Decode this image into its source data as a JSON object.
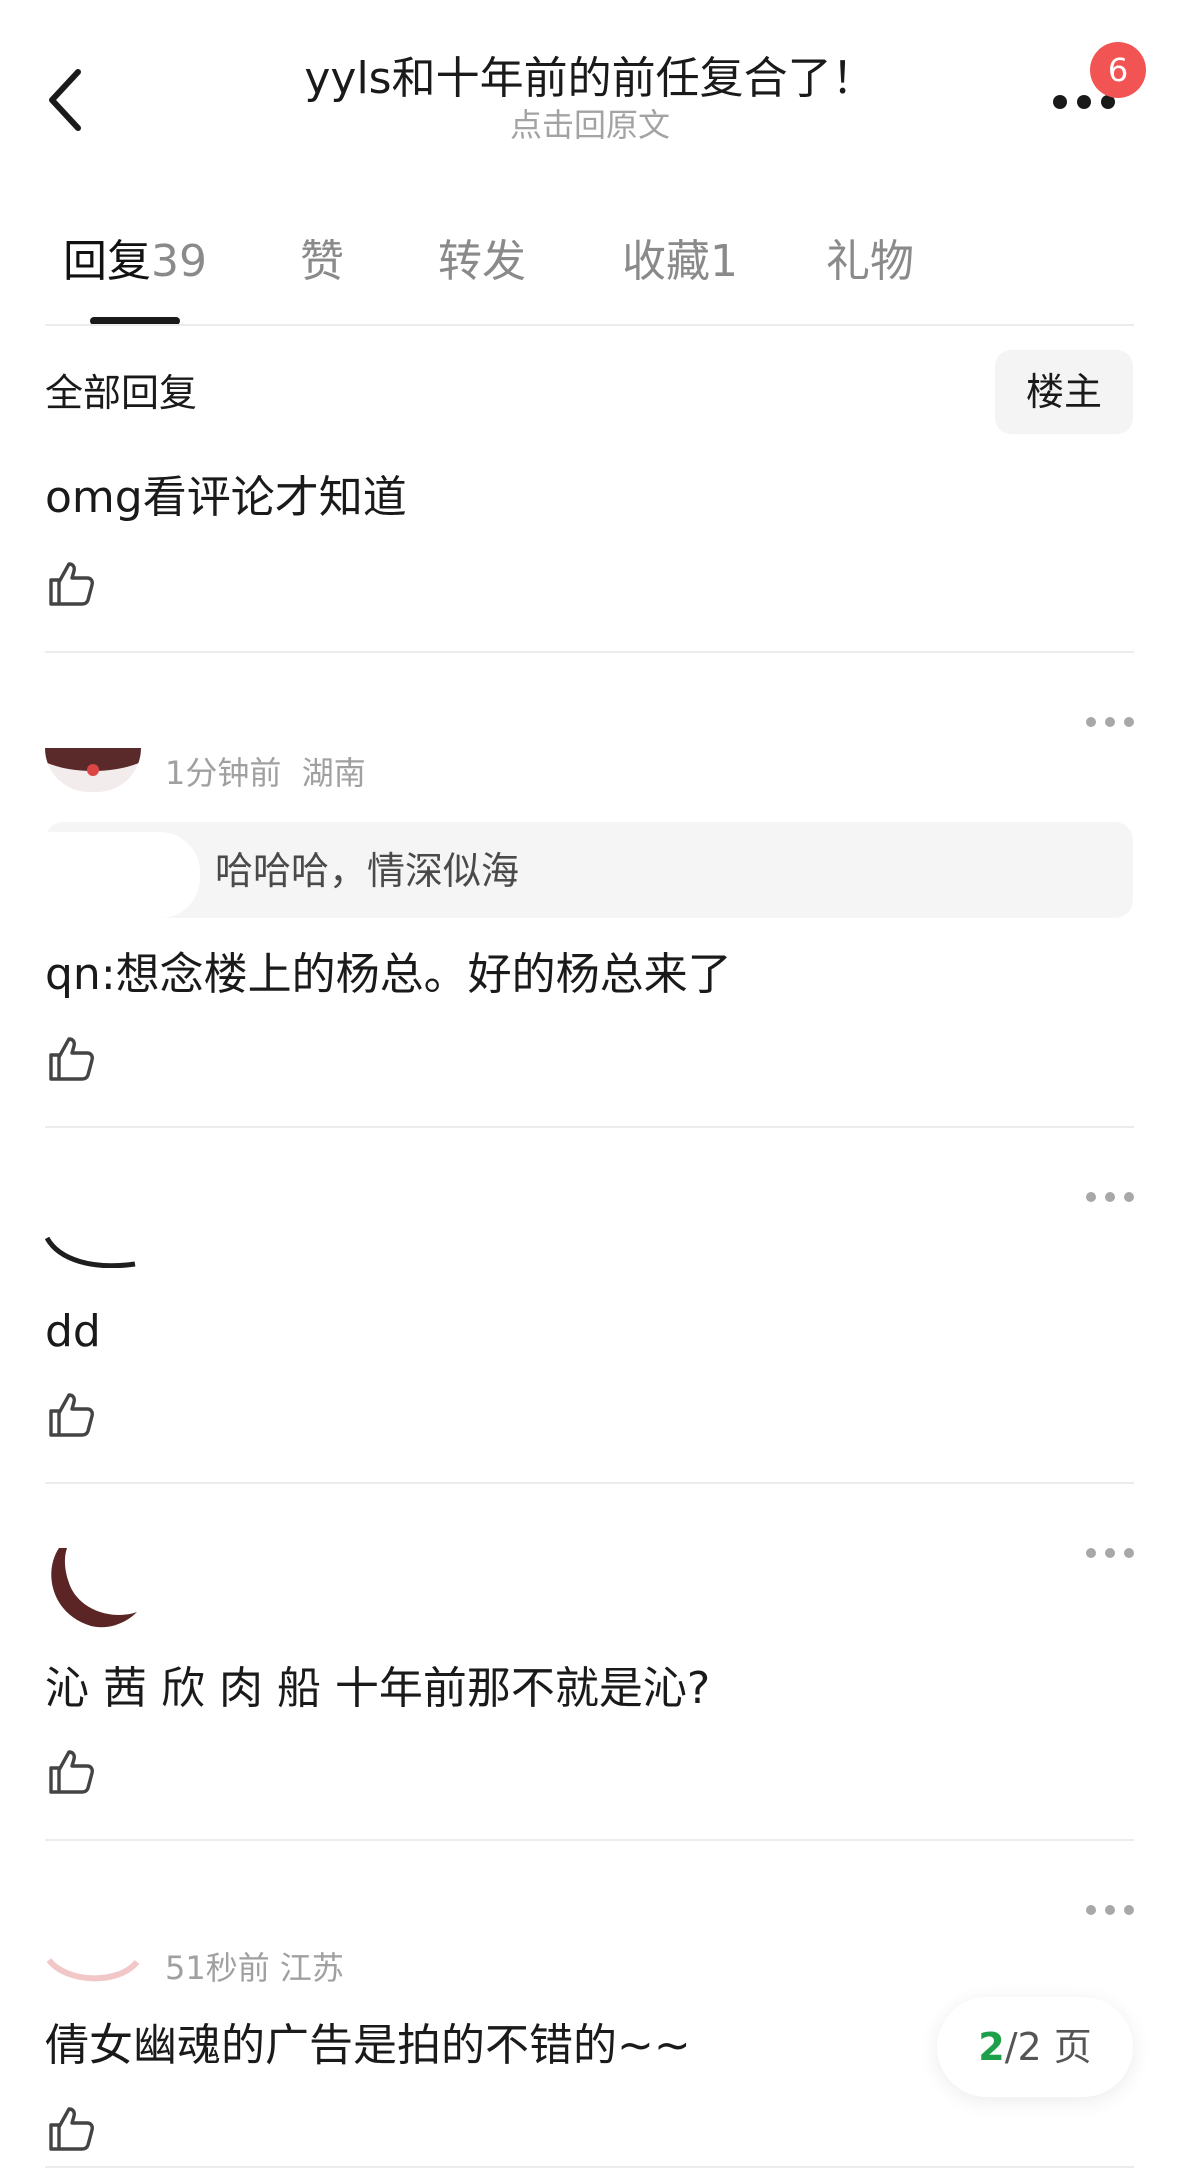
{
  "header": {
    "title": "yyls和十年前的前任复合了！",
    "subtitle": "点击回原文",
    "badge_count": "6"
  },
  "tabs": [
    {
      "label": "回复",
      "count": "39",
      "active": true
    },
    {
      "label": "赞",
      "count": ""
    },
    {
      "label": "转发",
      "count": ""
    },
    {
      "label": "收藏",
      "count": "1"
    },
    {
      "label": "礼物",
      "count": ""
    }
  ],
  "filter": {
    "all_label": "全部回复",
    "op_label": "楼主"
  },
  "comments": [
    {
      "text": "omg看评论才知道"
    },
    {
      "time": "1分钟前",
      "location": "湖南",
      "quote_text": "哈哈哈，情深似海",
      "text": "qn:想念楼上的杨总。好的杨总来了"
    },
    {
      "text": "dd"
    },
    {
      "text": "沁 茜 欣 肉 船 十年前那不就是沁?"
    },
    {
      "time": "51秒前",
      "location": "江苏",
      "text": "倩女幽魂的广告是拍的不错的~~"
    }
  ],
  "pager": {
    "current": "2",
    "rest": "/2 页"
  },
  "colors": {
    "badge": "#f25454",
    "pager_current": "#1ea04a",
    "muted_text": "#a0a0a0"
  }
}
